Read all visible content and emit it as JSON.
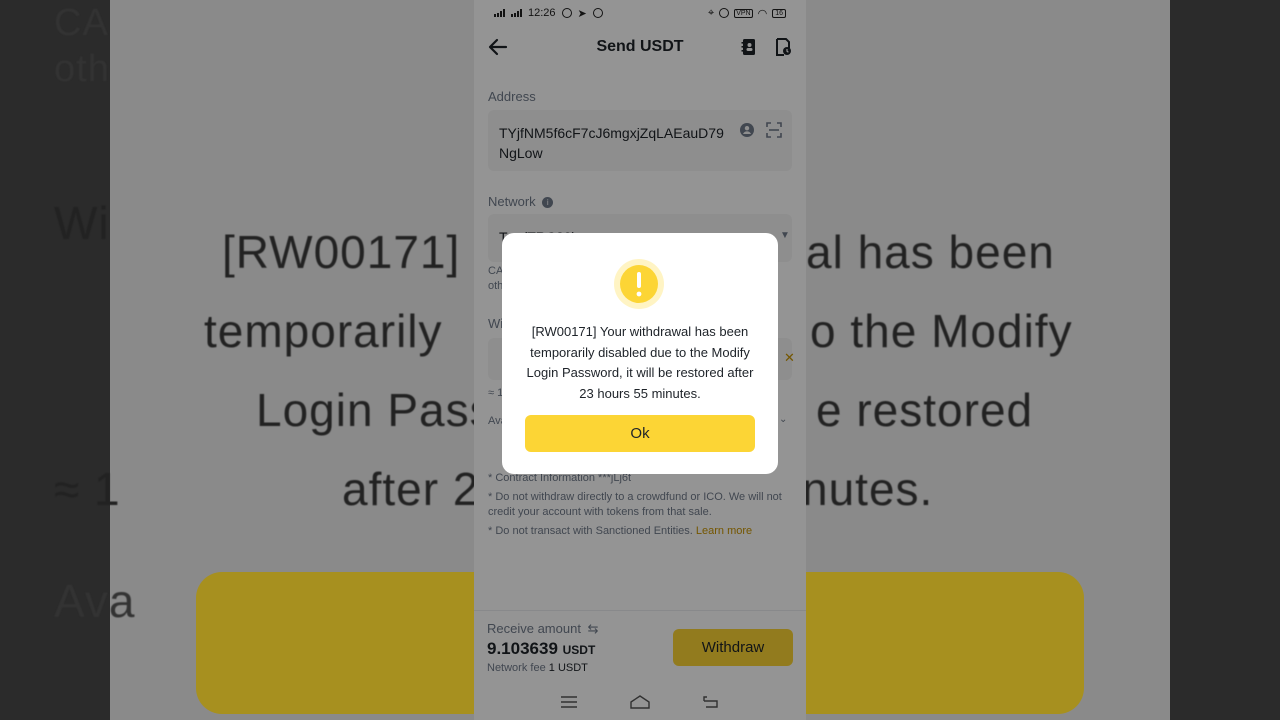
{
  "background": {
    "lines": [
      "[RW00171]",
      "al has been",
      "temporarily",
      "o the Modify",
      "Login Pass",
      "e restored",
      "after 2",
      "nutes."
    ],
    "top_left_fragment": "CA\noth",
    "left_fragment_wi": "Wi",
    "left_fragment_approx": "≈ 1",
    "left_fragment_ava": "Ava"
  },
  "status_bar": {
    "time": "12:26",
    "vpn": "VPN",
    "battery": "16"
  },
  "header": {
    "title": "Send USDT"
  },
  "address": {
    "label": "Address",
    "value": "TYjfNM5f6cF7cJ6mgxjZqLAEauD79NgLow"
  },
  "network": {
    "label": "Network",
    "value_partial": "Tr...(TRC20)",
    "note_partial": "CA\noth"
  },
  "withdraw_amount": {
    "label_partial": "Wi",
    "approx_partial": "≈ 1",
    "available_partial": "Ava"
  },
  "notes": {
    "contract": "* Contract Information ***jLj6t",
    "crowdfund": "* Do not withdraw directly to a crowdfund or ICO. We will not credit your account with tokens from that sale.",
    "sanctioned": "* Do not transact with Sanctioned Entities.",
    "learn_more": "Learn more"
  },
  "footer": {
    "receive_label": "Receive amount",
    "receive_value": "9.103639",
    "receive_unit": "USDT",
    "fee_label": "Network fee",
    "fee_value": "1 USDT",
    "withdraw_label": "Withdraw"
  },
  "dialog": {
    "message": "[RW00171] Your withdrawal has been temporarily disabled due to the Modify Login Password, it will be restored after 23 hours 55 minutes.",
    "ok_label": "Ok",
    "accent": "#fcd535"
  },
  "colors": {
    "brand_yellow": "#fcd535",
    "link": "#c99400",
    "text": "#1e2329",
    "muted": "#707a8a"
  }
}
